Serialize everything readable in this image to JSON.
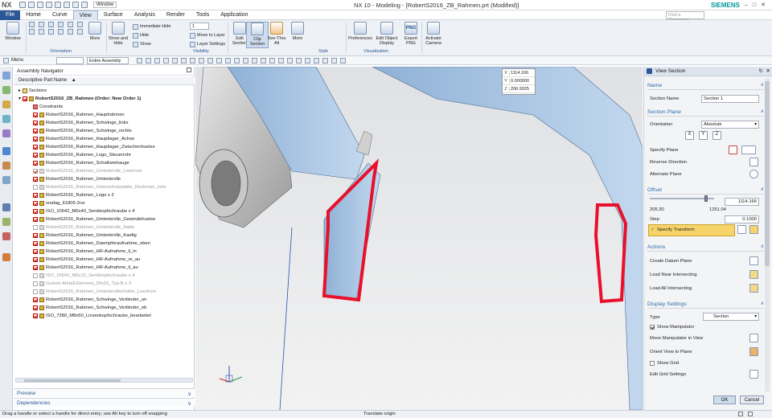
{
  "app": {
    "logo": "NX",
    "window_menu": "Window",
    "title": "NX 10 - Modeling - [RobertS2016_ZB_Rahmen.prt (Modified)]",
    "search_placeholder": "Find a Command",
    "brand": "SIEMENS"
  },
  "menu": {
    "tabs": [
      "File",
      "Home",
      "Curve",
      "View",
      "Surface",
      "Analysis",
      "Render",
      "Tools",
      "Application"
    ],
    "active": "View"
  },
  "ribbon": {
    "window": "Window",
    "more1": "More",
    "show_hide": "Show and Hide",
    "immediate_hide": "Immediate Hide",
    "hide": "Hide",
    "show": "Show",
    "layer_number": "1",
    "move_to_layer": "Move to Layer",
    "layer_settings": "Layer Settings",
    "edit_section": "Edit Section",
    "clip_section": "Clip Section",
    "see_thru": "See-Thru All",
    "more2": "More",
    "preferences": "Preferences",
    "edit_object_display": "Edit Object Display",
    "export_png": "Export PNG",
    "png_icon_text": "PNG",
    "activate_camera": "Activate Camera",
    "groups": [
      "Orientation",
      "Visibility",
      "Style",
      "Visualization"
    ]
  },
  "toolbar": {
    "menu": "Menu",
    "filter_value": "",
    "assembly_scope": "Entire Assembly"
  },
  "navigator": {
    "title": "Assembly Navigator",
    "column": "Descriptive Part Name",
    "items": [
      {
        "label": "Sections",
        "indent": 0,
        "checked": false,
        "dim": false,
        "kind": "folder"
      },
      {
        "label": "RobertS2016_ZB_Rahmen (Order: New Order 1)",
        "indent": 0,
        "checked": true,
        "dim": false,
        "kind": "root"
      },
      {
        "label": "Constraints",
        "indent": 1,
        "checked": false,
        "dim": false,
        "kind": "constraints"
      },
      {
        "label": "RobertS2016_Rahmen_Hauptrahmen",
        "indent": 1,
        "checked": true,
        "dim": false,
        "kind": "part"
      },
      {
        "label": "RobertS2016_Rahmen_Schwinge_links",
        "indent": 1,
        "checked": true,
        "dim": false,
        "kind": "part"
      },
      {
        "label": "RobertS2016_Rahmen_Schwinge_rechts",
        "indent": 1,
        "checked": true,
        "dim": false,
        "kind": "part"
      },
      {
        "label": "RobertS2016_Rahmen_Hauptlager_Achse",
        "indent": 1,
        "checked": true,
        "dim": false,
        "kind": "part"
      },
      {
        "label": "RobertS2016_Rahmen_Hauptlager_Zwischenhuelse",
        "indent": 1,
        "checked": true,
        "dim": false,
        "kind": "part"
      },
      {
        "label": "RobertS2016_Rahmen_Logo_Steuerrohr",
        "indent": 1,
        "checked": true,
        "dim": false,
        "kind": "part"
      },
      {
        "label": "RobertS2016_Rahmen_Schaltwerkauge",
        "indent": 1,
        "checked": true,
        "dim": false,
        "kind": "part"
      },
      {
        "label": "RobertS2016_Rahmen_Umlenkrolle_Leertrum",
        "indent": 1,
        "checked": true,
        "dim": true,
        "kind": "part"
      },
      {
        "label": "RobertS2016_Rahmen_Umlenkrolle",
        "indent": 1,
        "checked": true,
        "dim": false,
        "kind": "part"
      },
      {
        "label": "RobertS2016_Rahmen_Unterschutzplatte_Rockman_mini",
        "indent": 1,
        "checked": false,
        "dim": true,
        "kind": "part"
      },
      {
        "label": "RobertS2016_Rahmen_Logo x 2",
        "indent": 1,
        "checked": true,
        "dim": false,
        "kind": "part"
      },
      {
        "label": "snafag_61805-2rsr",
        "indent": 1,
        "checked": true,
        "dim": false,
        "kind": "part"
      },
      {
        "label": "ISO_10642_M6x40_Senkkopfschraube x 4",
        "indent": 1,
        "checked": true,
        "dim": false,
        "kind": "part"
      },
      {
        "label": "RobertS2016_Rahmen_Umlenkrolle_Gewindehuelse",
        "indent": 1,
        "checked": true,
        "dim": false,
        "kind": "part"
      },
      {
        "label": "RobertS2016_Rahmen_Umlenkrolle_Nabe",
        "indent": 1,
        "checked": false,
        "dim": true,
        "kind": "part"
      },
      {
        "label": "RobertS2016_Rahmen_Umlenkrolle_Kaefig",
        "indent": 1,
        "checked": true,
        "dim": false,
        "kind": "part"
      },
      {
        "label": "RobertS2016_Rahmen_Daempferaufnahme_oben",
        "indent": 1,
        "checked": true,
        "dim": false,
        "kind": "part"
      },
      {
        "label": "RobertS2016_Rahmen_HR-Aufnahme_li_in",
        "indent": 1,
        "checked": true,
        "dim": false,
        "kind": "part"
      },
      {
        "label": "RobertS2016_Rahmen_HR-Aufnahme_re_au",
        "indent": 1,
        "checked": true,
        "dim": false,
        "kind": "part"
      },
      {
        "label": "RobertS2016_Rahmen_HR-Aufnahme_li_au",
        "indent": 1,
        "checked": true,
        "dim": false,
        "kind": "part"
      },
      {
        "label": "ISO_10642_M6x12_Senkkopfschraube x 4",
        "indent": 1,
        "checked": false,
        "dim": true,
        "kind": "part"
      },
      {
        "label": "Gummi-Metall-Element_20x15_Typ-B x 3",
        "indent": 1,
        "checked": false,
        "dim": true,
        "kind": "part"
      },
      {
        "label": "RobertS2016_Rahmen_Umlenkrollenhalter_Leertrum",
        "indent": 1,
        "checked": false,
        "dim": true,
        "kind": "part"
      },
      {
        "label": "RobertS2016_Rahmen_Schwinge_Verbinder_un",
        "indent": 1,
        "checked": true,
        "dim": false,
        "kind": "part"
      },
      {
        "label": "RobertS2016_Rahmen_Schwinge_Verbinder_ob",
        "indent": 1,
        "checked": true,
        "dim": false,
        "kind": "part"
      },
      {
        "label": "ISO_7380_M8x50_Linsenkopfschraube_bearbeitet",
        "indent": 1,
        "checked": true,
        "dim": false,
        "kind": "part"
      }
    ],
    "preview": "Preview",
    "dependencies": "Dependencies"
  },
  "coords": {
    "x_label": "X",
    "x": "1114.166",
    "y_label": "Y",
    "y": "0.000000",
    "z_label": "Z",
    "z": "206.9325"
  },
  "panel": {
    "title": "View Section",
    "name_section": "Name",
    "section_name_label": "Section Name",
    "section_name_value": "Section 1",
    "section_plane": "Section Plane",
    "orientation_label": "Orientation",
    "orientation_value": "Absolute",
    "axis_buttons": [
      "X",
      "Y",
      "Z"
    ],
    "specify_plane": "Specify Plane",
    "reverse_direction": "Reverse Direction",
    "alternate_plane": "Alternate Plane",
    "offset": "Offset",
    "offset_value": "1114.166",
    "slider_min": "205.30",
    "slider_max": "1251.04",
    "slider_fraction": 0.87,
    "step_label": "Step",
    "step_value": "0.1000",
    "specify_transform": "Specify Transform",
    "actions": "Actions",
    "create_datum_plane": "Create Datum Plane",
    "load_near_intersecting": "Load Near Intersecting",
    "load_all_intersecting": "Load All Intersecting",
    "display_settings": "Display Settings",
    "type_label": "Type",
    "type_value": "Section",
    "show_manipulator": "Show Manipulator",
    "show_manipulator_checked": true,
    "move_manipulator": "Move Manipulator in View",
    "orient_view": "Orient View to Plane",
    "show_grid": "Show Grid",
    "show_grid_checked": false,
    "edit_grid": "Edit Grid Settings",
    "ok": "OK",
    "cancel": "Cancel"
  },
  "status": {
    "left": "Drag a handle or select a handle for direct entry; use Alt key to turn off snapping",
    "center": "Translate origin"
  },
  "colors": {
    "accent": "#2b5797",
    "section_red": "#e8102a",
    "part_blue": "#a9c6e6",
    "highlight": "#f6d46a"
  }
}
